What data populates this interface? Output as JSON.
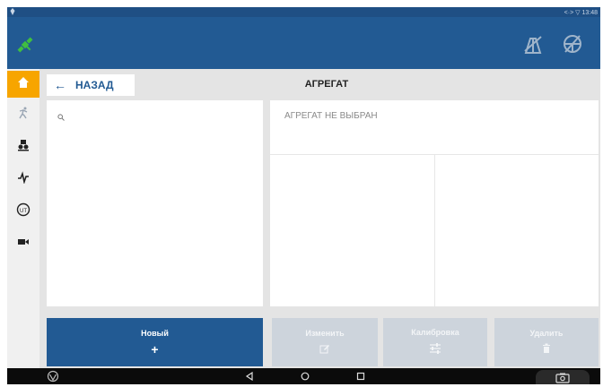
{
  "status_bar": {
    "icons": [
      "gps-icon",
      "link-icon",
      "signal-icon"
    ],
    "time": "13:48"
  },
  "app_bar": {
    "icons": [
      "satellite-icon",
      "field-tool-icon",
      "steering-wheel-icon"
    ]
  },
  "sidebar": {
    "items": [
      {
        "icon": "home-icon",
        "active": true
      },
      {
        "icon": "running-person-icon",
        "active": false
      },
      {
        "icon": "tractor-icon",
        "active": false
      },
      {
        "icon": "pulse-icon",
        "active": false
      },
      {
        "icon": "isobus-icon",
        "label": "UT",
        "active": false
      },
      {
        "icon": "camera-icon",
        "active": false
      }
    ]
  },
  "header": {
    "back_label": "НАЗАД",
    "title": "АГРЕГАТ"
  },
  "list_panel": {
    "search_icon": "search-icon"
  },
  "detail_panel": {
    "empty_label": "АГРЕГАТ НЕ ВЫБРАН"
  },
  "actions": {
    "new_label": "Новый",
    "edit_label": "Изменить",
    "calibrate_label": "Калибровка",
    "delete_label": "Удалить"
  },
  "nav_bar": {
    "icons": [
      "app-logo-icon",
      "back-icon",
      "home-circle-icon",
      "recents-icon",
      "screenshot-icon"
    ]
  },
  "colors": {
    "primary": "#225a93",
    "accent": "#f7a500",
    "disabled": "#cdd4dc",
    "satellite": "#3fbf3f"
  }
}
